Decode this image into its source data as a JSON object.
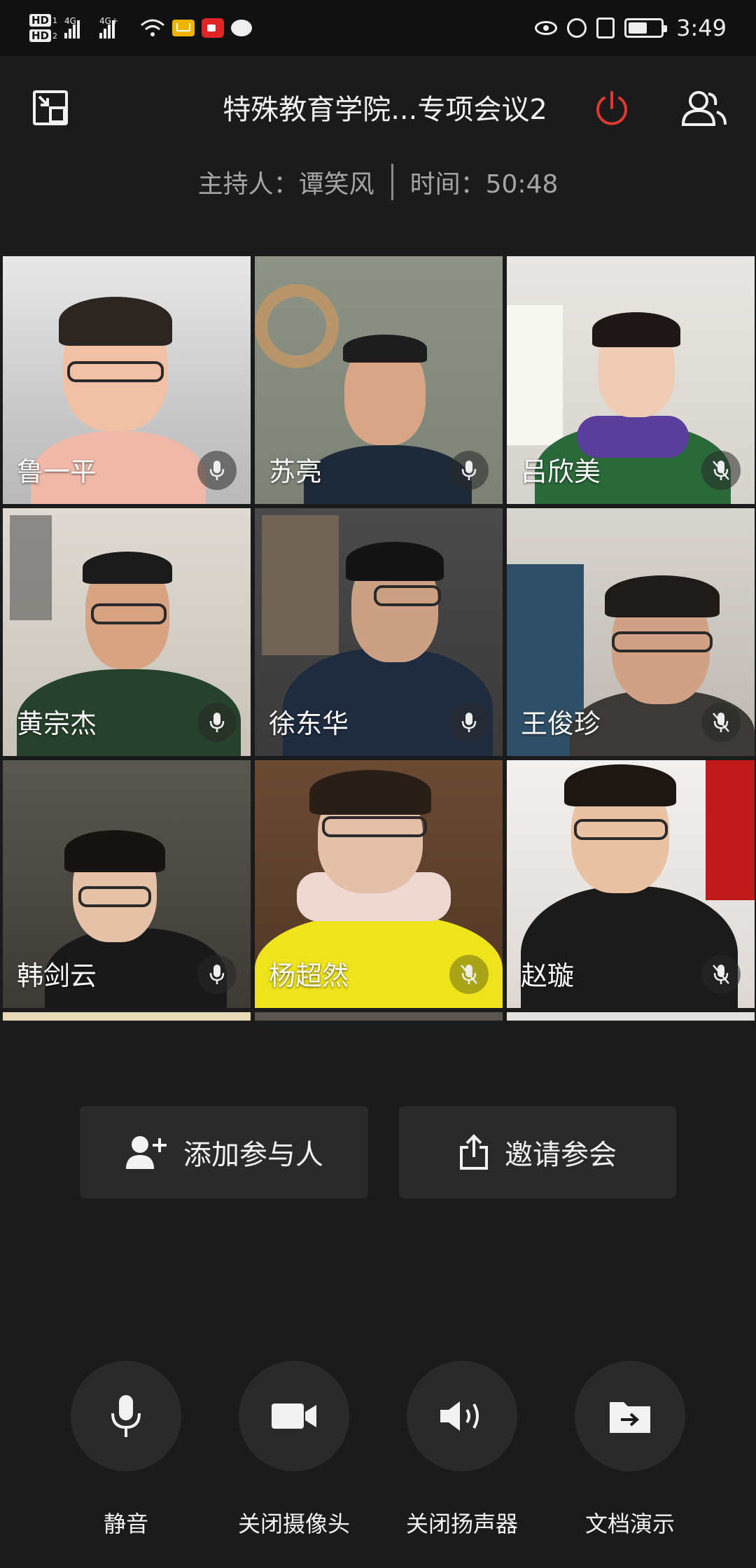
{
  "status_bar": {
    "sim1_label": "HD",
    "sim1_index": "1",
    "sim2_label": "HD",
    "sim2_index": "2",
    "net1": "4G",
    "net2": "4G+",
    "battery_level": 0.6,
    "time": "3:49"
  },
  "header": {
    "title": "特殊教育学院...专项会议2",
    "host_label": "主持人：谭笑风",
    "time_label": "时间：50:48"
  },
  "participants": [
    {
      "name": "鲁一平"
    },
    {
      "name": "苏亮"
    },
    {
      "name": "吕欣美"
    },
    {
      "name": "黄宗杰"
    },
    {
      "name": "徐东华"
    },
    {
      "name": "王俊珍"
    },
    {
      "name": "韩剑云"
    },
    {
      "name": "杨超然"
    },
    {
      "name": "赵璇"
    }
  ],
  "actions": {
    "add_participant": "添加参与人",
    "invite": "邀请参会"
  },
  "toolbar": {
    "mute": "静音",
    "camera_off": "关闭摄像头",
    "speaker_off": "关闭扬声器",
    "doc_share": "文档演示"
  },
  "colors": {
    "background": "#1b1b1b",
    "button_bg": "#2a2a2a",
    "power_red": "#e03a2f"
  }
}
